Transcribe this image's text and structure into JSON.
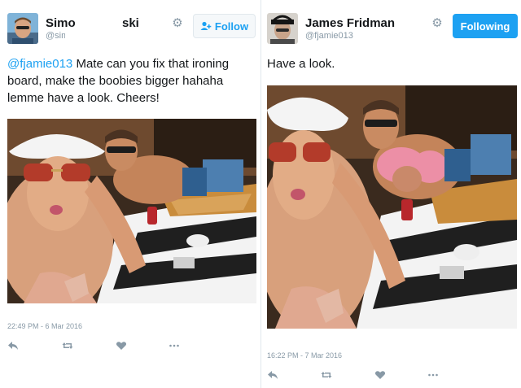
{
  "left_tweet": {
    "author_name_start": "Simo",
    "author_name_end": "ski",
    "author_handle": "@sim",
    "follow_label": "Follow",
    "mention": "@fjamie013",
    "text": " Mate can you fix that ironing board, make the boobies bigger hahaha lemme have a look. Cheers!",
    "timestamp": "22:49 PM - 6 Mar 2016"
  },
  "right_tweet": {
    "author_name": "James Fridman",
    "author_handle": "@fjamie013",
    "following_label": "Following",
    "text": "Have a look.",
    "timestamp": "16:22 PM - 7 Mar 2016"
  },
  "colors": {
    "twitter_blue": "#1da1f2",
    "muted_text": "#8899a6",
    "border": "#e1e8ed"
  },
  "icons": [
    "gear-icon",
    "person-plus-icon",
    "reply-icon",
    "retweet-icon",
    "heart-icon",
    "more-icon"
  ]
}
